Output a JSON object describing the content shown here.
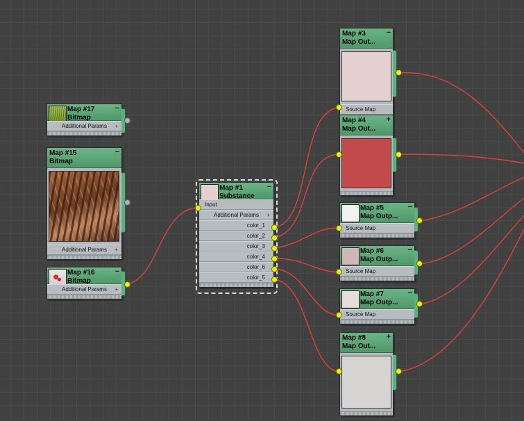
{
  "colors": {
    "background": "#414141",
    "wire": "#e0403a",
    "node_header": "#5ba877",
    "socket": "#e6f20f",
    "map1_swatch": "#e7cfcf",
    "map3_swatch": "#e4d0d0",
    "map4_swatch": "#c24a4a",
    "map5_swatch": "#f2f2f0",
    "map6_swatch": "#cfb6b8",
    "map7_swatch": "#e6dedd",
    "map8_swatch": "#d6d4d2"
  },
  "nodes": {
    "map17": {
      "name": "Map #17",
      "type": "Bitmap",
      "params": "Additional Params"
    },
    "map15": {
      "name": "Map #15",
      "type": "Bitmap",
      "params": "Additional Params"
    },
    "map16": {
      "name": "Map #16",
      "type": "Bitmap",
      "params": "Additional Params"
    },
    "map1": {
      "name": "Map #1",
      "type": "Substance",
      "input": "Input",
      "params": "Additional Params",
      "outputs": [
        "color_1",
        "color_2",
        "color_3",
        "color_4",
        "color_6",
        "color_5"
      ]
    },
    "map3": {
      "name": "Map #3",
      "type": "Map Out...",
      "slot": "Source Map"
    },
    "map4": {
      "name": "Map #4",
      "type": "Map Out..."
    },
    "map5": {
      "name": "Map #5",
      "type": "Map  Outp...",
      "slot": "Source Map"
    },
    "map6": {
      "name": "Map #6",
      "type": "Map  Outp...",
      "slot": "Source Map"
    },
    "map7": {
      "name": "Map #7",
      "type": "Map  Outp...",
      "slot": "Source Map"
    },
    "map8": {
      "name": "Map #8",
      "type": "Map Out..."
    }
  },
  "icons": {
    "collapse": "−",
    "expand": "+",
    "rollout_plus": "+"
  }
}
